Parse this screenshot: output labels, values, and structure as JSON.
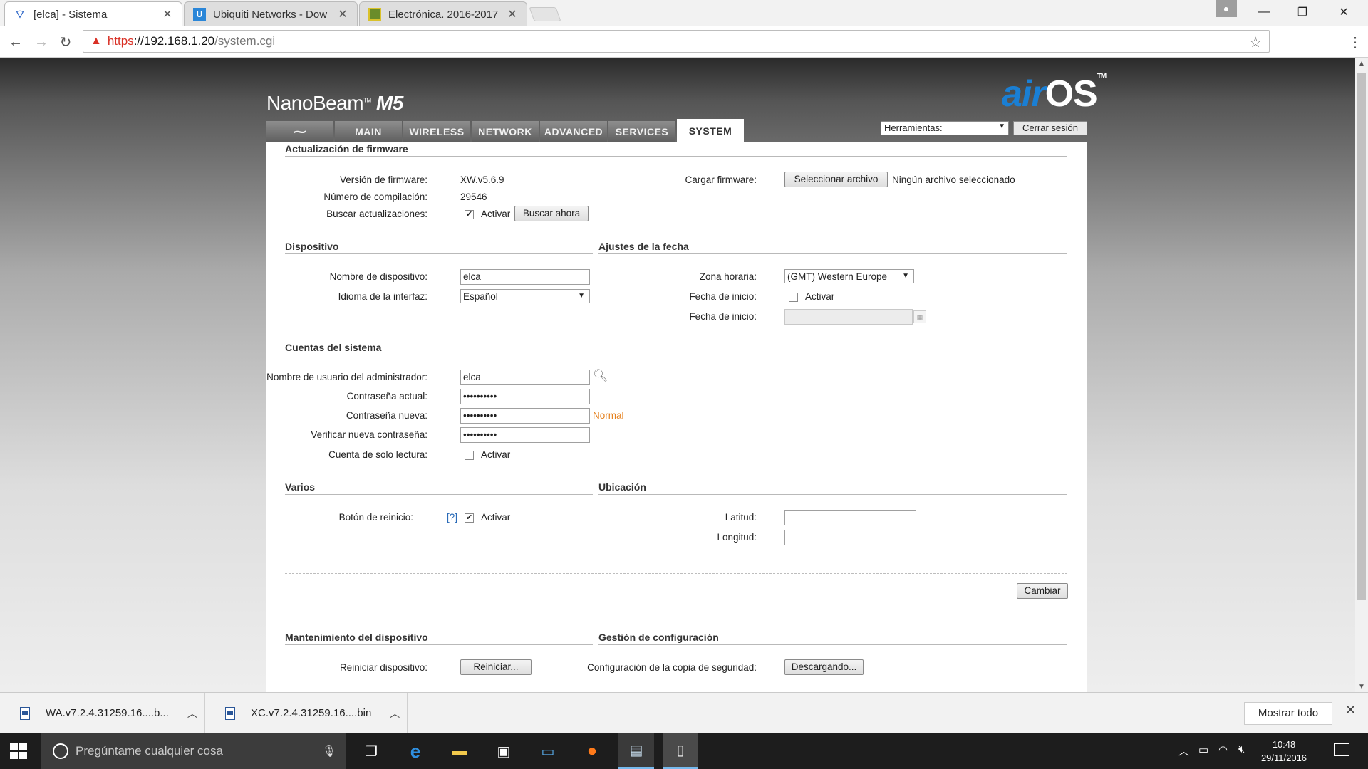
{
  "browser": {
    "tabs": [
      {
        "title": "[elca] - Sistema",
        "active": true
      },
      {
        "title": "Ubiquiti Networks - Dow",
        "active": false
      },
      {
        "title": "Electrónica. 2016-2017",
        "active": false
      }
    ],
    "url_scheme": "https",
    "url_host": "://192.168.1.20",
    "url_path": "/system.cgi"
  },
  "header": {
    "model": "NanoBeam",
    "model_suffix": "M5",
    "brand_air": "air",
    "brand_os": "OS",
    "tools_select": "Herramientas:",
    "logout_label": "Cerrar sesión"
  },
  "nav": {
    "tabs": [
      "MAIN",
      "WIRELESS",
      "NETWORK",
      "ADVANCED",
      "SERVICES",
      "SYSTEM"
    ],
    "active": "SYSTEM"
  },
  "firmware": {
    "title": "Actualización de firmware",
    "version_label": "Versión de firmware:",
    "version_value": "XW.v5.6.9",
    "build_label": "Número de compilación:",
    "build_value": "29546",
    "check_label": "Buscar actualizaciones:",
    "check_option": "Activar",
    "check_button": "Buscar ahora",
    "upload_label": "Cargar firmware:",
    "upload_button": "Seleccionar archivo",
    "upload_status": "Ningún archivo seleccionado"
  },
  "device": {
    "title": "Dispositivo",
    "name_label": "Nombre de dispositivo:",
    "name_value": "elca",
    "lang_label": "Idioma de la interfaz:",
    "lang_value": "Español"
  },
  "date": {
    "title": "Ajustes de la fecha",
    "tz_label": "Zona horaria:",
    "tz_value": "(GMT) Western Europe",
    "start_label": "Fecha de inicio:",
    "start_option": "Activar",
    "start_date_label": "Fecha de inicio:"
  },
  "accounts": {
    "title": "Cuentas del sistema",
    "admin_label": "Nombre de usuario del administrador:",
    "admin_value": "elca",
    "cur_pw_label": "Contraseña actual:",
    "cur_pw_value": "••••••••••",
    "new_pw_label": "Contraseña nueva:",
    "new_pw_value": "••••••••••",
    "strength": "Normal",
    "verify_label": "Verificar nueva contraseña:",
    "verify_value": "••••••••••",
    "readonly_label": "Cuenta de solo lectura:",
    "readonly_option": "Activar"
  },
  "misc": {
    "title": "Varios",
    "reset_label": "Botón de reinicio:",
    "reset_help": "[?]",
    "reset_option": "Activar"
  },
  "location": {
    "title": "Ubicación",
    "lat_label": "Latitud:",
    "lon_label": "Longitud:"
  },
  "change_button": "Cambiar",
  "maintenance": {
    "title": "Mantenimiento del dispositivo",
    "reboot_label": "Reiniciar dispositivo:",
    "reboot_button": "Reiniciar..."
  },
  "config": {
    "title": "Gestión de configuración",
    "backup_label": "Configuración de la copia de seguridad:",
    "backup_button": "Descargando..."
  },
  "downloads": {
    "items": [
      "WA.v7.2.4.31259.16....b...",
      "XC.v7.2.4.31259.16....bin"
    ],
    "show_all": "Mostrar todo"
  },
  "taskbar": {
    "search_placeholder": "Pregúntame cualquier cosa",
    "time": "10:48",
    "date": "29/11/2016"
  }
}
